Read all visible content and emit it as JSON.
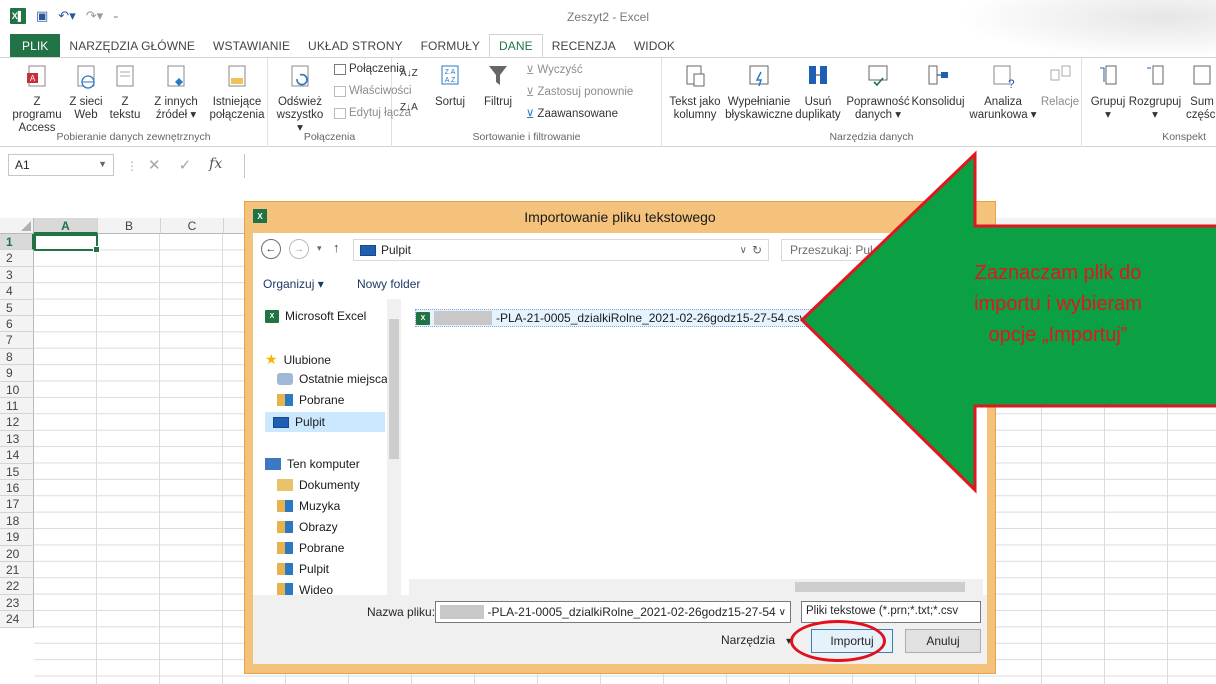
{
  "window": {
    "title": "Zeszyt2 - Excel",
    "logo": "X│"
  },
  "tabs": [
    "PLIK",
    "NARZĘDZIA GŁÓWNE",
    "WSTAWIANIE",
    "UKŁAD STRONY",
    "FORMUŁY",
    "DANE",
    "RECENZJA",
    "WIDOK"
  ],
  "ribbon": {
    "g1": {
      "label": "Pobieranie danych zewnętrznych",
      "b1a": "Z programu",
      "b1b": "Access",
      "b2a": "Z sieci",
      "b2b": "Web",
      "b3a": "Z",
      "b3b": "tekstu",
      "b4a": "Z innych",
      "b4b": "źródeł ▾",
      "b5a": "Istniejące",
      "b5b": "połączenia"
    },
    "g2": {
      "label": "Połączenia",
      "b1a": "Odśwież",
      "b1b": "wszystko ▾",
      "s1": "Połączenia",
      "s2": "Właściwości",
      "s3": "Edytuj łącza"
    },
    "g3": {
      "label": "Sortowanie i filtrowanie",
      "sort": "Sortuj",
      "filter": "Filtruj",
      "s1": "Wyczyść",
      "s2": "Zastosuj ponownie",
      "s3": "Zaawansowane"
    },
    "g4": {
      "label": "Narzędzia danych",
      "b1a": "Tekst jako",
      "b1b": "kolumny",
      "b2a": "Wypełnianie",
      "b2b": "błyskawiczne",
      "b3a": "Usuń",
      "b3b": "duplikaty",
      "b4a": "Poprawność",
      "b4b": "danych ▾",
      "b5a": "Konsoliduj",
      "b6a": "Analiza",
      "b6b": "warunkowa ▾",
      "b7a": "Relacje"
    },
    "g5": {
      "label": "Konspekt",
      "b1a": "Grupuj",
      "b1b": "▾",
      "b2a": "Rozgrupuj",
      "b2b": "▾",
      "b3a": "Sum",
      "b3b": "części"
    }
  },
  "formula_bar": {
    "name_box": "A1",
    "fx": "fx"
  },
  "sheet": {
    "columns": [
      "A",
      "B",
      "C"
    ],
    "rows": [
      "1",
      "2",
      "3",
      "4",
      "5",
      "6",
      "7",
      "8",
      "9",
      "10",
      "11",
      "12",
      "13",
      "14",
      "15",
      "16",
      "17",
      "18",
      "19",
      "20",
      "21",
      "22",
      "23",
      "24"
    ],
    "active_cell": "A1"
  },
  "dialog": {
    "title": "Importowanie pliku tekstowego",
    "address": "Pulpit",
    "search_placeholder": "Przeszukaj: Pul",
    "organize": "Organizuj ▾",
    "new_folder": "Nowy folder",
    "nav": {
      "microsoft_excel": "Microsoft Excel",
      "favorites": "Ulubione",
      "recent": "Ostatnie miejsca",
      "downloads": "Pobrane",
      "desktop": "Pulpit",
      "computer": "Ten komputer",
      "documents": "Dokumenty",
      "music": "Muzyka",
      "pictures": "Obrazy",
      "downloads2": "Pobrane",
      "desktop2": "Pulpit",
      "videos": "Wideo"
    },
    "file": "-PLA-21-0005_dzialkiRolne_2021-02-26godz15-27-54.csv",
    "filename_label": "Nazwa pliku:",
    "filename_value": "-PLA-21-0005_dzialkiRolne_2021-02-26godz15-27-54",
    "filetype": "Pliki tekstowe (*.prn;*.txt;*.csv",
    "tools": "Narzędzia",
    "import_button": "Importuj",
    "cancel_button": "Anuluj"
  },
  "annotation": {
    "line1": "Zaznaczam plik do",
    "line2": "importu i wybieram",
    "line3": "opcje „Importuj”",
    "arrow_color": "#0aa043",
    "border_color": "#e2161f"
  }
}
